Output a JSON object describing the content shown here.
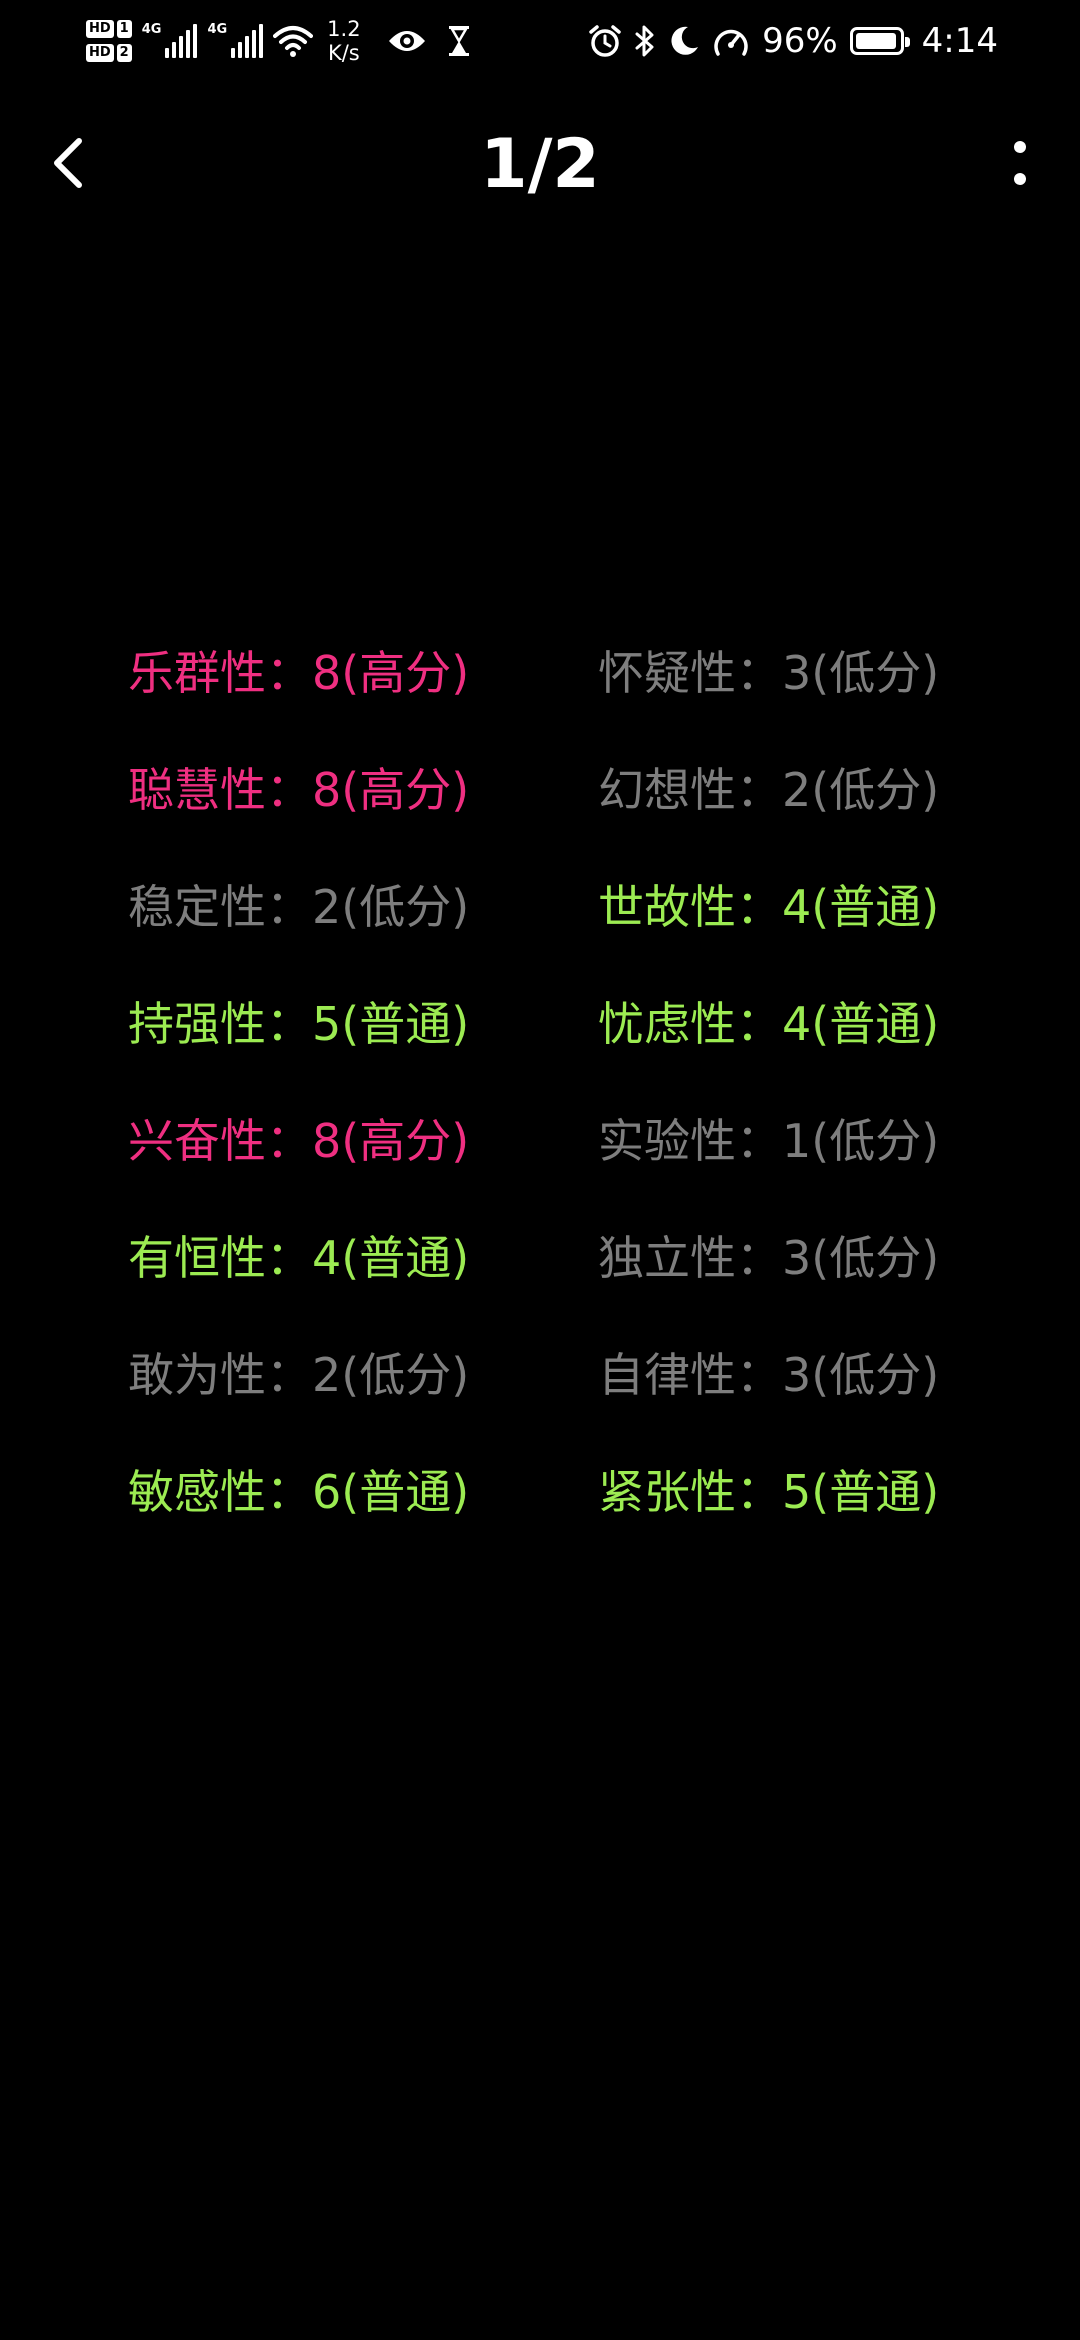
{
  "status_bar": {
    "hd1": "HD",
    "sim1": "1",
    "hd2": "HD",
    "sim2": "2",
    "net1": "4G",
    "net2": "4G",
    "speed_value": "1.2",
    "speed_unit": "K/s",
    "battery_percent": "96%",
    "battery_level": 0.96,
    "time": "4:14",
    "icons": [
      "signal-icon",
      "wifi-icon",
      "eye-icon",
      "hourglass-icon",
      "alarm-icon",
      "bluetooth-icon",
      "moon-icon",
      "speedometer-icon",
      "battery-icon"
    ]
  },
  "app_bar": {
    "title": "1/2",
    "back_icon": "chevron-left-icon",
    "menu_icon": "more-vertical-icon"
  },
  "colors": {
    "high": "#ef2f81",
    "normal": "#9ceb52",
    "low": "#7e7e7e",
    "background": "#000000"
  },
  "traits": [
    {
      "name": "乐群性",
      "sep": "：",
      "score": "8",
      "level": "(高分)",
      "level_key": "high"
    },
    {
      "name": "怀疑性",
      "sep": "：",
      "score": "3",
      "level": "(低分)",
      "level_key": "low"
    },
    {
      "name": "聪慧性",
      "sep": "：",
      "score": "8",
      "level": "(高分)",
      "level_key": "high"
    },
    {
      "name": "幻想性",
      "sep": "：",
      "score": "2",
      "level": "(低分)",
      "level_key": "low"
    },
    {
      "name": "稳定性",
      "sep": "：",
      "score": "2",
      "level": "(低分)",
      "level_key": "low"
    },
    {
      "name": "世故性",
      "sep": "：",
      "score": "4",
      "level": "(普通)",
      "level_key": "normal"
    },
    {
      "name": "持强性",
      "sep": "：",
      "score": "5",
      "level": "(普通)",
      "level_key": "normal"
    },
    {
      "name": "忧虑性",
      "sep": "：",
      "score": "4",
      "level": "(普通)",
      "level_key": "normal"
    },
    {
      "name": "兴奋性",
      "sep": "：",
      "score": "8",
      "level": "(高分)",
      "level_key": "high"
    },
    {
      "name": "实验性",
      "sep": "：",
      "score": "1",
      "level": "(低分)",
      "level_key": "low"
    },
    {
      "name": "有恒性",
      "sep": "：",
      "score": "4",
      "level": "(普通)",
      "level_key": "normal"
    },
    {
      "name": "独立性",
      "sep": "：",
      "score": "3",
      "level": "(低分)",
      "level_key": "low"
    },
    {
      "name": "敢为性",
      "sep": "：",
      "score": "2",
      "level": "(低分)",
      "level_key": "low"
    },
    {
      "name": "自律性",
      "sep": "：",
      "score": "3",
      "level": "(低分)",
      "level_key": "low"
    },
    {
      "name": "敏感性",
      "sep": "：",
      "score": "6",
      "level": "(普通)",
      "level_key": "normal"
    },
    {
      "name": "紧张性",
      "sep": "：",
      "score": "5",
      "level": "(普通)",
      "level_key": "normal"
    }
  ]
}
